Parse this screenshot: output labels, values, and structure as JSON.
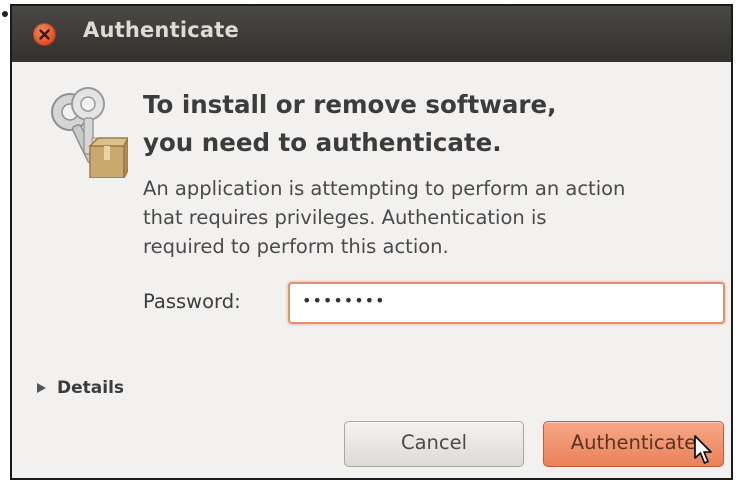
{
  "window": {
    "title": "Authenticate"
  },
  "dialog": {
    "heading_line1": "To install or remove software,",
    "heading_line2": "you need to authenticate.",
    "description_line1": "An application is attempting to perform an action",
    "description_line2": "that requires privileges. Authentication is",
    "description_line3": "required to perform this action.",
    "password_label": "Password:",
    "password_value": "••••••••",
    "details_label": "Details"
  },
  "buttons": {
    "cancel_label": "Cancel",
    "authenticate_label": "Authenticate"
  },
  "icons": {
    "close": "close-icon",
    "keys": "keys-icon",
    "details_expander": "triangle-right-icon",
    "cursor": "mouse-pointer-icon"
  },
  "colors": {
    "titlebar": "#3c3b37",
    "close_button": "#e2542c",
    "accent": "#e9825a",
    "focus_border": "#e0926d"
  }
}
